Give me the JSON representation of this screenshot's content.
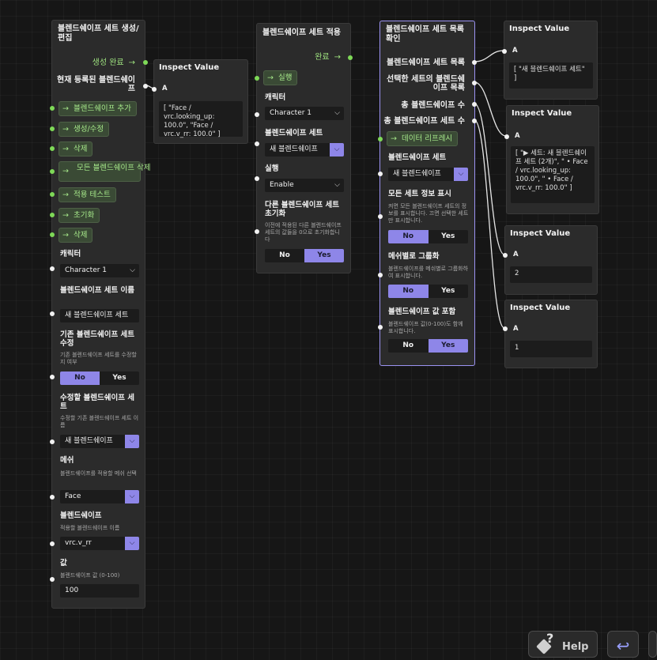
{
  "node1": {
    "title": "블렌드쉐이프 세트 생성/편집",
    "out_complete": "생성 완료",
    "out_current": "현재 등록된 블렌드쉐이프",
    "buttons": [
      "블렌드쉐이프 추가",
      "생성/수정",
      "삭제",
      "모든 블렌드쉐이프 삭제",
      "적용 테스트",
      "초기화",
      "삭제"
    ],
    "character_label": "캐릭터",
    "character_value": "Character 1",
    "setname_label": "블렌드쉐이프 세트 이름",
    "setname_value": "새 블렌드쉐이프 세트",
    "modify_label": "기존 블렌드쉐이프 세트 수정",
    "modify_desc": "기존 블렌드쉐이프 세트를 수정할지 여부",
    "modify_no": "No",
    "modify_yes": "Yes",
    "target_label": "수정할 블렌드쉐이프 세트",
    "target_desc": "수정할 기존 블렌드쉐이프 세트 이름",
    "target_value": "새 블렌드쉐이프",
    "mesh_label": "메쉬",
    "mesh_desc": "블렌드쉐이프를 적용할 메쉬 선택",
    "mesh_value": "Face",
    "blend_label": "블렌드쉐이프",
    "blend_desc": "적용할 블렌드쉐이프 이름",
    "blend_value": "vrc.v_rr",
    "value_label": "값",
    "value_desc": "블렌드쉐이프 값 (0-100)",
    "value_value": "100"
  },
  "inspect1": {
    "title": "Inspect Value",
    "port": "A",
    "value": "[ \"Face / vrc.looking_up: 100.0\", \"Face / vrc.v_rr: 100.0\" ]"
  },
  "node2": {
    "title": "블렌드쉐이프 세트 적용",
    "out_complete": "완료",
    "exec": "실행",
    "character_label": "캐릭터",
    "character_value": "Character 1",
    "set_label": "블렌드쉐이프 세트",
    "set_value": "새 블렌드쉐이프",
    "run_label": "실행",
    "run_value": "Enable",
    "reset_label": "다른 블렌드쉐이프 세트 초기화",
    "reset_desc": "이전에 적용된 다른 블렌드쉐이프 세트의 값들을 0으로 초기화합니다",
    "reset_no": "No",
    "reset_yes": "Yes"
  },
  "node3": {
    "title": "블렌드쉐이프 세트 목록 확인",
    "out_list": "블렌드쉐이프 세트 목록",
    "out_selected": "선택한 세트의 블렌드쉐이프 목록",
    "out_count": "총 블렌드쉐이프 수",
    "out_setcount": "총 블렌드쉐이프 세트 수",
    "refresh": "데이터 리프레시",
    "set_label": "블렌드쉐이프 세트",
    "set_value": "새 블렌드쉐이프",
    "showall_label": "모든 세트 정보 표시",
    "showall_desc": "켜면 모든 블렌드쉐이프 세트의 정보를 표시합니다. 끄면 선택한 세트만 표시합니다.",
    "showall_no": "No",
    "showall_yes": "Yes",
    "group_label": "메쉬별로 그룹화",
    "group_desc": "블렌드쉐이프를 메쉬별로 그룹화하여 표시합니다.",
    "group_no": "No",
    "group_yes": "Yes",
    "include_label": "블렌드쉐이프 값 포함",
    "include_desc": "블렌드쉐이프 값(0-100)도 함께 표시합니다.",
    "include_no": "No",
    "include_yes": "Yes"
  },
  "inspect2": {
    "title": "Inspect Value",
    "port": "A",
    "value": "[ \"새 블렌드쉐이프 세트\" ]"
  },
  "inspect3": {
    "title": "Inspect Value",
    "port": "A",
    "value": "[ \"▶ 세트: 새 블렌드쉐이프 세트 (2개)\", \" • Face / vrc.looking_up: 100.0\", \" • Face / vrc.v_rr: 100.0\" ]"
  },
  "inspect4": {
    "title": "Inspect Value",
    "port": "A",
    "value": "2"
  },
  "inspect5": {
    "title": "Inspect Value",
    "port": "A",
    "value": "1"
  },
  "toolbar": {
    "help": "Help",
    "help_glyph": "?",
    "undo_glyph": "↩"
  },
  "glyphs": {
    "arrow": "→",
    "chevron": "⌵"
  },
  "colors": {
    "accent": "#8e86e8",
    "exec_green": "#7ed957",
    "node_bg": "#2b2b2b",
    "canvas_bg": "#161616"
  }
}
